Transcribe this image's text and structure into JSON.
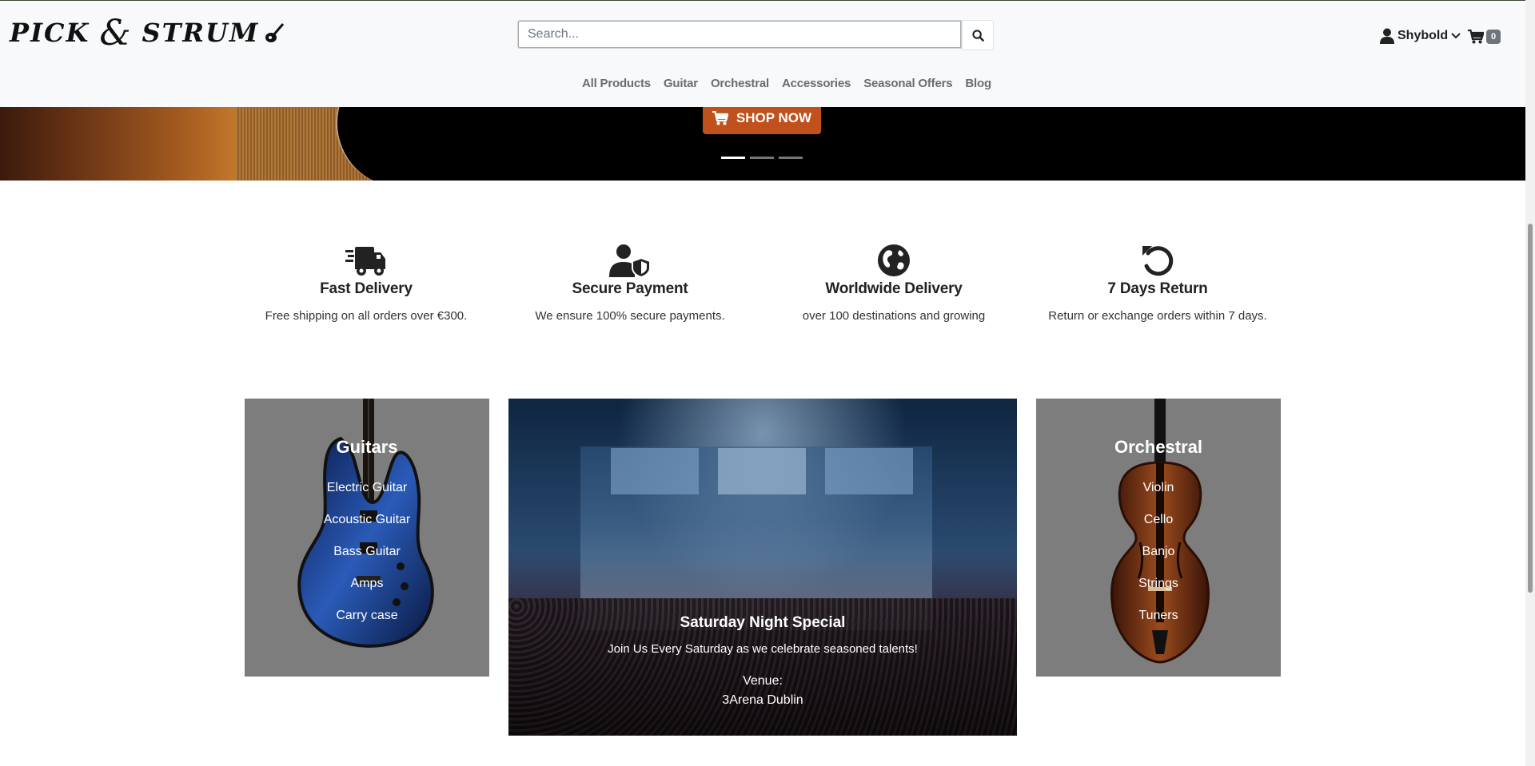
{
  "header": {
    "logo_text_left": "PICK",
    "logo_amp": "&",
    "logo_text_right": "STRUM",
    "search_placeholder": "Search...",
    "user_name": "Shybold",
    "cart_count": "0",
    "nav": [
      "All Products",
      "Guitar",
      "Orchestral",
      "Accessories",
      "Seasonal Offers",
      "Blog"
    ]
  },
  "hero": {
    "shop_now": "SHOP NOW",
    "slide_count": 3,
    "active_slide": 1
  },
  "features": [
    {
      "icon": "truck-fast-icon",
      "title": "Fast Delivery",
      "text": "Free shipping on all orders over €300."
    },
    {
      "icon": "user-shield-icon",
      "title": "Secure Payment",
      "text": "We ensure 100% secure payments."
    },
    {
      "icon": "globe-icon",
      "title": "Worldwide Delivery",
      "text": "over 100 destinations and growing"
    },
    {
      "icon": "rotate-left-icon",
      "title": "7 Days Return",
      "text": "Return or exchange orders within 7 days."
    }
  ],
  "categories": {
    "guitars": {
      "title": "Guitars",
      "items": [
        "Electric Guitar",
        "Acoustic Guitar",
        "Bass Guitar",
        "Amps",
        "Carry case"
      ]
    },
    "orchestral": {
      "title": "Orchestral",
      "items": [
        "Violin",
        "Cello",
        "Banjo",
        "Strings",
        "Tuners"
      ]
    }
  },
  "event": {
    "title": "Saturday Night Special",
    "description": "Join Us Every Saturday as we celebrate seasoned talents!",
    "venue_label": "Venue:",
    "venue": "3Arena Dublin"
  },
  "colors": {
    "header_bg": "#f8f9fa",
    "shop_button": "#c0501c",
    "category_card_bg": "#7d7d7d",
    "nav_text": "#6c6c6c"
  }
}
